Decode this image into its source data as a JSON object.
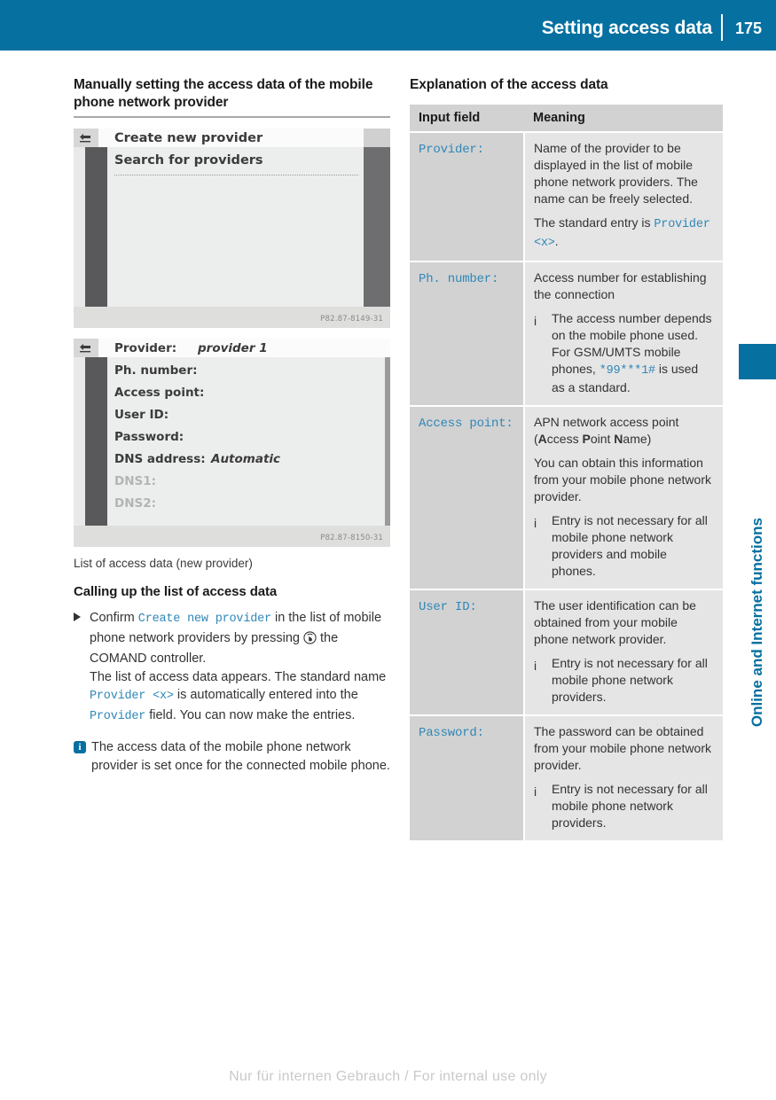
{
  "header": {
    "title": "Setting access data",
    "page_number": "175"
  },
  "chapter_tab": {
    "label": "Online and Internet functions",
    "accent_color": "#0670a0"
  },
  "left": {
    "section_title": "Manually setting the access data of the mobile phone network provider",
    "figure_1": {
      "code": "P82.87-8149-31",
      "back_icon": "back-arrow-icon",
      "items": [
        "Create new provider",
        "Search for providers"
      ]
    },
    "figure_2": {
      "code": "P82.87-8150-31",
      "back_icon": "back-arrow-icon",
      "fields": [
        {
          "label": "Provider:",
          "value": "provider 1",
          "dim": false
        },
        {
          "label": "Ph. number:",
          "value": "",
          "dim": false
        },
        {
          "label": "Access point:",
          "value": "",
          "dim": false
        },
        {
          "label": "User ID:",
          "value": "",
          "dim": false
        },
        {
          "label": "Password:",
          "value": "",
          "dim": false
        },
        {
          "label": "DNS address:",
          "value": "Automatic",
          "dim": false
        },
        {
          "label": "DNS1:",
          "value": "",
          "dim": true
        },
        {
          "label": "DNS2:",
          "value": "",
          "dim": true
        }
      ]
    },
    "caption": "List of access data (new provider)",
    "sub_title": "Calling up the list of access data",
    "step": {
      "bullet_icon": "triangle-bullet-icon",
      "text_1": "Confirm ",
      "code_1": "Create new provider",
      "text_2": " in the list of mobile phone network providers by pressing ",
      "controller_icon": "comand-controller-icon",
      "text_3": " the COMAND controller.",
      "text_4": "The list of access data appears. The standard name ",
      "code_2": "Provider <x>",
      "text_5": " is automatically entered into the ",
      "code_3": "Provider",
      "text_6": " field. You can now make the entries."
    },
    "note": {
      "icon": "info-icon",
      "text": "The access data of the mobile phone network provider is set once for the connected mobile phone."
    }
  },
  "right": {
    "section_title": "Explanation of the access data",
    "table": {
      "headers": [
        "Input field",
        "Meaning"
      ],
      "rows": [
        {
          "field": "Provider:",
          "paragraphs": [
            "Name of the provider to be displayed in the list of mobile phone network providers. The name can be freely selected."
          ],
          "trailing_text": "The standard entry is ",
          "trailing_code": "Provider <x>",
          "trailing_tail": ".",
          "note": null
        },
        {
          "field": "Ph. number:",
          "paragraphs": [
            "Access number for establishing the connection"
          ],
          "note": {
            "icon": "info-icon",
            "pre": "The access number depends on the mobile phone used. For GSM/UMTS mobile phones, ",
            "code": "*99***1#",
            "post": " is used as a standard."
          }
        },
        {
          "field": "Access point:",
          "paragraphs": [
            "APN network access point (Access Point Name)",
            "You can obtain this information from your mobile phone network provider."
          ],
          "acronym_bold": [
            "A",
            "P",
            "N"
          ],
          "note": {
            "icon": "info-icon",
            "pre": "Entry is not necessary for all mobile phone network providers and mobile phones.",
            "code": "",
            "post": ""
          }
        },
        {
          "field": "User ID:",
          "paragraphs": [
            "The user identification can be obtained from your mobile phone network provider."
          ],
          "note": {
            "icon": "info-icon",
            "pre": "Entry is not necessary for all mobile phone network providers.",
            "code": "",
            "post": ""
          }
        },
        {
          "field": "Password:",
          "paragraphs": [
            "The password can be obtained from your mobile phone network provider."
          ],
          "note": {
            "icon": "info-icon",
            "pre": "Entry is not necessary for all mobile phone network providers.",
            "code": "",
            "post": ""
          }
        }
      ]
    }
  },
  "footer": {
    "text": "Nur für internen Gebrauch / For internal use only"
  }
}
